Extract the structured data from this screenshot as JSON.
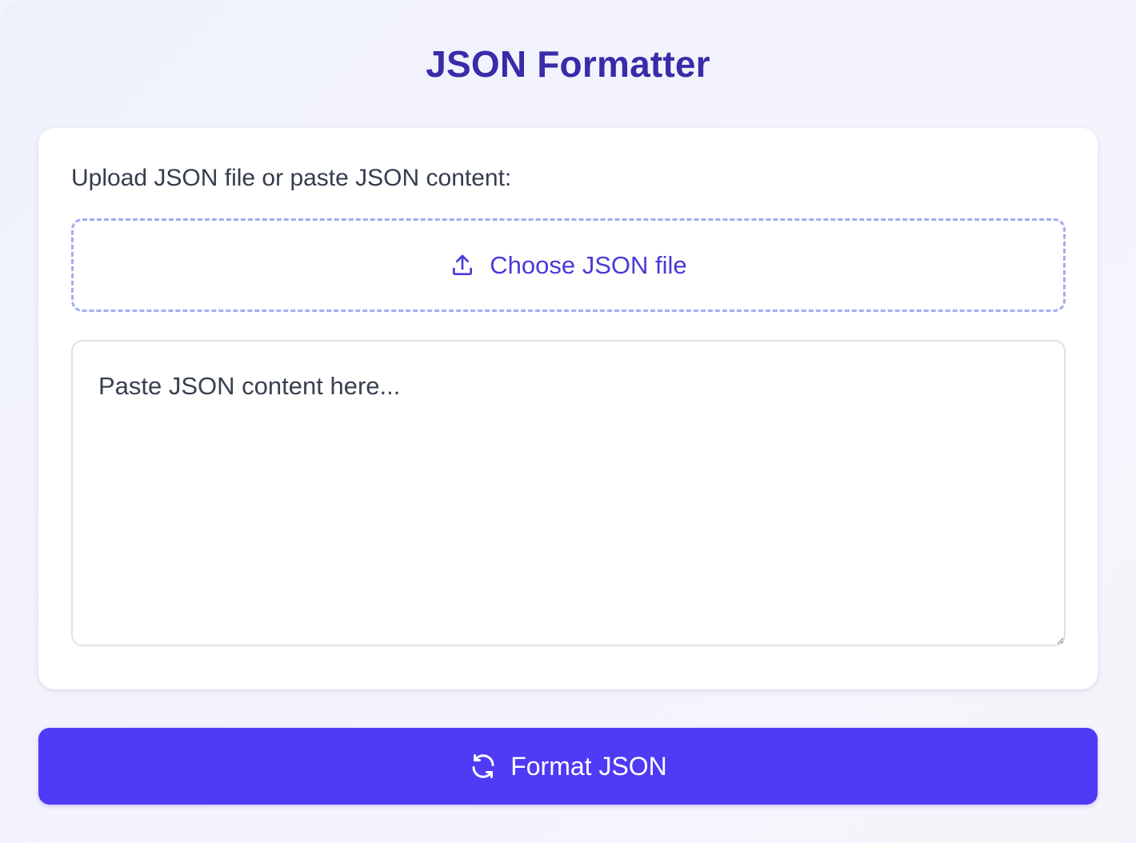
{
  "page": {
    "title": "JSON Formatter"
  },
  "upload": {
    "label": "Upload JSON file or paste JSON content:",
    "choose_file_label": "Choose JSON file",
    "icon": "upload-icon"
  },
  "editor": {
    "placeholder": "Paste JSON content here...",
    "value": ""
  },
  "actions": {
    "format_label": "Format JSON",
    "format_icon": "refresh-icon"
  },
  "colors": {
    "title": "#3a2ba8",
    "accent": "#4f3af5",
    "link": "#4a3ad9",
    "dashed_border": "#a3adf2"
  }
}
